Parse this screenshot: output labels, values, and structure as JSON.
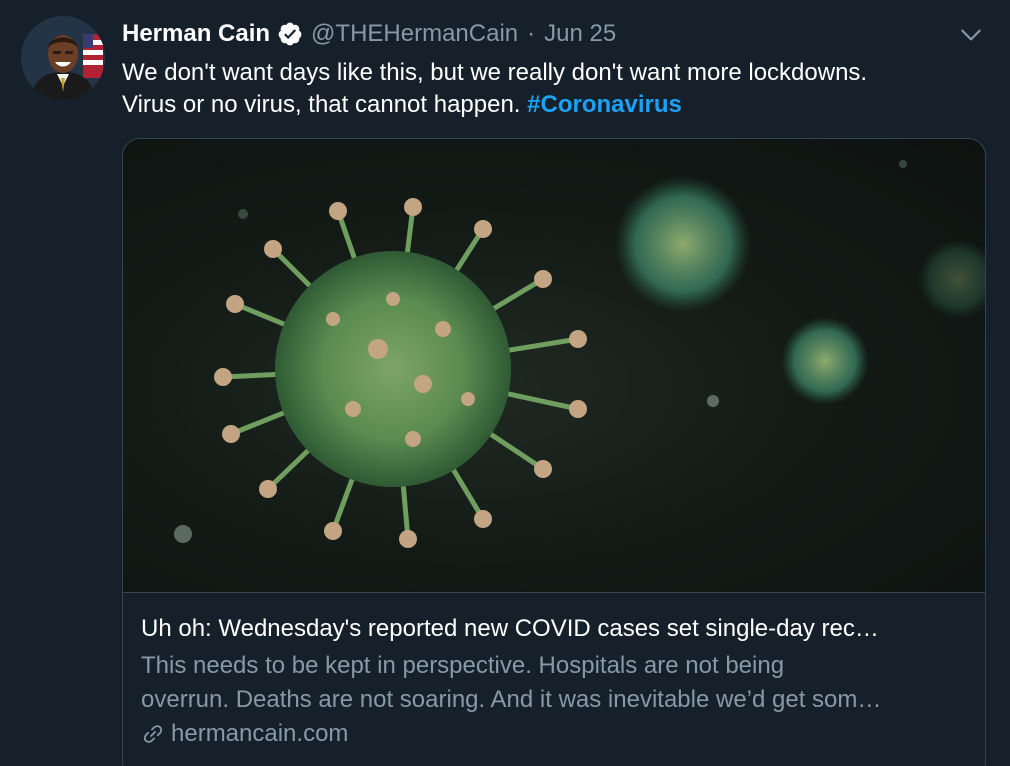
{
  "tweet": {
    "author": {
      "name": "Herman Cain",
      "handle": "@THEHermanCain",
      "verified": true,
      "avatar_icon": "profile-photo"
    },
    "separator": "·",
    "date": "Jun 25",
    "text": {
      "line1": "We don't want days like this, but we really don't want more lockdowns.",
      "line2": "Virus or no virus, that cannot happen.",
      "hashtag": "#Coronavirus"
    },
    "card": {
      "image_icon": "coronavirus-illustration",
      "title": "Uh oh: Wednesday's reported new COVID cases set single-day rec…",
      "description_line1": "This needs to be kept in perspective. Hospitals are not being",
      "description_line2": "overrun. Deaths are not soaring. And it was inevitable we’d get som…",
      "domain": "hermancain.com"
    }
  },
  "colors": {
    "background": "#15202b",
    "primary_text": "#ffffff",
    "secondary_text": "#8899a6",
    "accent": "#1da1f2",
    "border": "#38444d"
  }
}
